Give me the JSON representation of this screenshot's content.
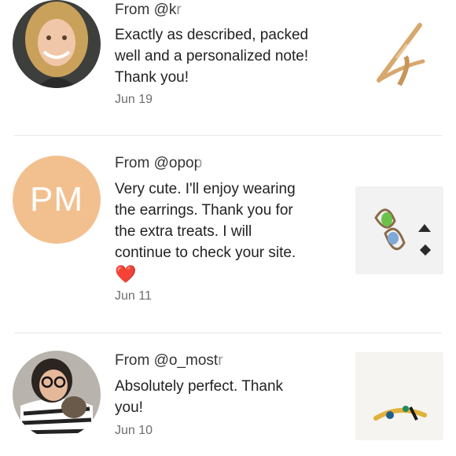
{
  "reviews": [
    {
      "from_prefix": "From @kr",
      "text_lines": [
        "Exactly as described, packed",
        "well and a personalized note!",
        "Thank you!"
      ],
      "date": "Jun 19"
    },
    {
      "from_prefix": "From @opop",
      "avatar_initials": "PM",
      "text_lines": [
        "Very cute. I'll enjoy wearing",
        "the earrings. Thank you for",
        "the extra treats. I will",
        "continue to check your site."
      ],
      "emoji": "❤️",
      "date": "Jun 11"
    },
    {
      "from_prefix": "From @o_mostr",
      "text_lines": [
        "Absolutely perfect. Thank",
        "you!"
      ],
      "date": "Jun 10"
    }
  ],
  "colors": {
    "avatar_pm": "#f2c08f",
    "date_text": "#6e6e6e",
    "divider": "#e6e6e6"
  }
}
